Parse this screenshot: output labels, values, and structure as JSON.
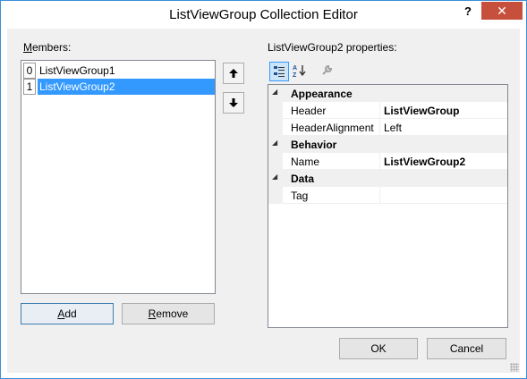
{
  "window": {
    "title": "ListViewGroup Collection Editor",
    "help_label": "?",
    "close_label": "✕"
  },
  "members": {
    "label": "Members:",
    "items": [
      {
        "index": "0",
        "name": "ListViewGroup1",
        "selected": false
      },
      {
        "index": "1",
        "name": "ListViewGroup2",
        "selected": true
      }
    ],
    "add_label": "Add",
    "remove_label": "Remove"
  },
  "properties": {
    "label": "ListViewGroup2 properties:",
    "toolbar": [
      "categorized-icon",
      "alphabetical-icon",
      "property-pages-icon"
    ],
    "categories": [
      {
        "name": "Appearance",
        "rows": [
          {
            "name": "Header",
            "value": "ListViewGroup",
            "bold": true
          },
          {
            "name": "HeaderAlignment",
            "value": "Left",
            "bold": false
          }
        ]
      },
      {
        "name": "Behavior",
        "rows": [
          {
            "name": "Name",
            "value": "ListViewGroup2",
            "bold": true
          }
        ]
      },
      {
        "name": "Data",
        "rows": [
          {
            "name": "Tag",
            "value": "",
            "bold": false
          }
        ]
      }
    ]
  },
  "buttons": {
    "ok_label": "OK",
    "cancel_label": "Cancel"
  },
  "colors": {
    "selection": "#3399ff",
    "close": "#c7503d",
    "border": "#3a8ed8"
  }
}
